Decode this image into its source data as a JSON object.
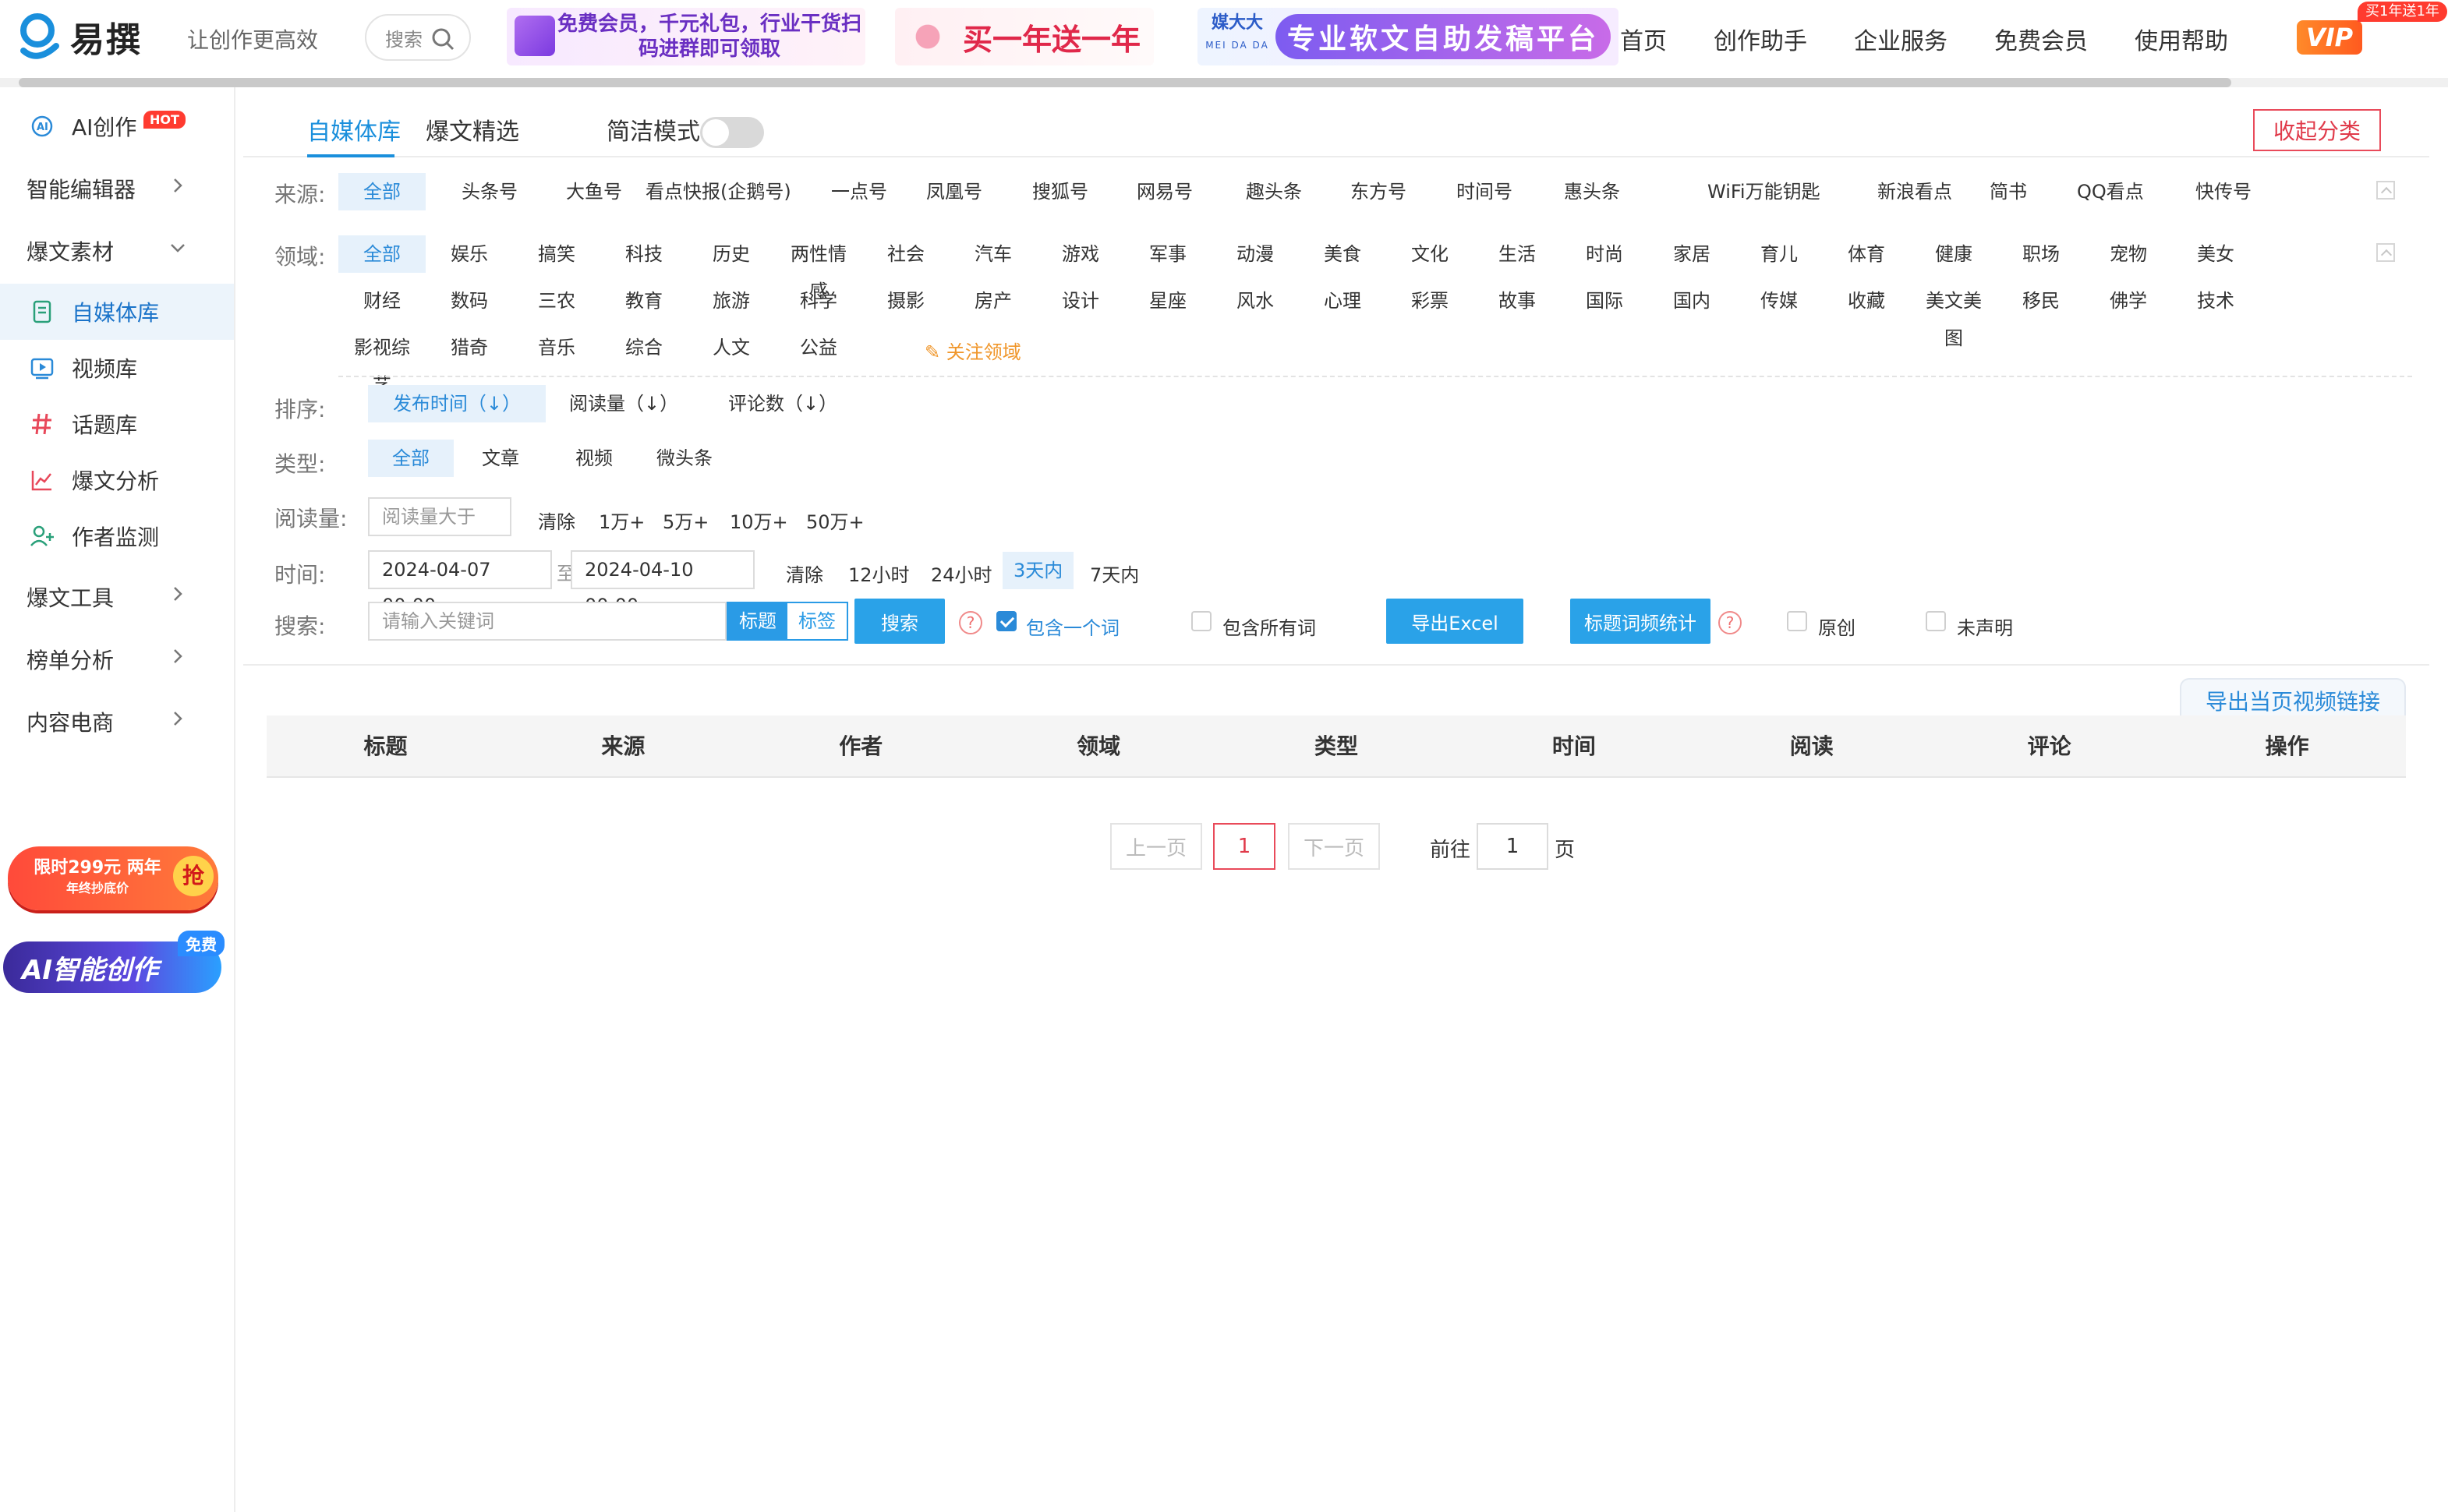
{
  "header": {
    "logo_text": "易撰",
    "slogan": "让创作更高效",
    "search_label": "搜索",
    "banner1": "免费会员，千元礼包，行业干货扫码进群即可领取",
    "banner2": "买一年送一年",
    "banner3_brand": "媒大大",
    "banner3_brand_sub": "MEI DA DA",
    "banner3": "专业软文自助发稿平台",
    "nav": [
      "首页",
      "创作助手",
      "企业服务",
      "免费会员",
      "使用帮助"
    ],
    "vip": "VIP",
    "vip_tag": "买1年送1年"
  },
  "sidebar": {
    "ai": "AI创作",
    "ai_badge": "HOT",
    "items": [
      {
        "label": "智能编辑器",
        "icon": "chevron-right-icon"
      },
      {
        "label": "爆文素材",
        "icon": "chevron-down-icon"
      },
      {
        "label": "自媒体库",
        "icon": "document-icon"
      },
      {
        "label": "视频库",
        "icon": "video-icon"
      },
      {
        "label": "话题库",
        "icon": "hashtag-icon"
      },
      {
        "label": "爆文分析",
        "icon": "line-chart-icon"
      },
      {
        "label": "作者监测",
        "icon": "add-user-icon"
      },
      {
        "label": "爆文工具",
        "icon": "chevron-right-icon"
      },
      {
        "label": "榜单分析",
        "icon": "chevron-right-icon"
      },
      {
        "label": "内容电商",
        "icon": "chevron-right-icon"
      }
    ],
    "promo1": "限时299元 两年",
    "promo1_sub": "年终抄底价",
    "promo1_badge": "抢",
    "promo2": "AI智能创作",
    "promo2_badge": "免费"
  },
  "main": {
    "tabs": [
      "自媒体库",
      "爆文精选"
    ],
    "mode_label": "简洁模式",
    "collapse_label": "收起分类",
    "source_label": "来源:",
    "sources": [
      "全部",
      "头条号",
      "大鱼号",
      "看点快报(企鹅号)",
      "一点号",
      "凤凰号",
      "搜狐号",
      "网易号",
      "趣头条",
      "东方号",
      "时间号",
      "惠头条",
      "WiFi万能钥匙",
      "新浪看点",
      "简书",
      "QQ看点",
      "快传号"
    ],
    "domain_label": "领域:",
    "domains_row1": [
      "全部",
      "娱乐",
      "搞笑",
      "科技",
      "历史",
      "两性情感",
      "社会",
      "汽车",
      "游戏",
      "军事",
      "动漫",
      "美食",
      "文化",
      "生活",
      "时尚",
      "家居",
      "育儿",
      "体育",
      "健康",
      "职场",
      "宠物",
      "美女"
    ],
    "domains_row2": [
      "财经",
      "数码",
      "三农",
      "教育",
      "旅游",
      "科学",
      "摄影",
      "房产",
      "设计",
      "星座",
      "风水",
      "心理",
      "彩票",
      "故事",
      "国际",
      "国内",
      "传媒",
      "收藏",
      "美文美图",
      "移民",
      "佛学",
      "技术"
    ],
    "domains_row3": [
      "影视综艺",
      "猎奇",
      "音乐",
      "综合",
      "人文",
      "公益"
    ],
    "follow_domain": "关注领域",
    "sort_label": "排序:",
    "sorts": [
      "发布时间（↓）",
      "阅读量（↓）",
      "评论数（↓）"
    ],
    "type_label": "类型:",
    "types": [
      "全部",
      "文章",
      "视频",
      "微头条"
    ],
    "read_label": "阅读量:",
    "read_placeholder": "阅读量大于",
    "read_options": [
      "清除",
      "1万+",
      "5万+",
      "10万+",
      "50万+"
    ],
    "time_label": "时间:",
    "time_start": "2024-04-07 00:00",
    "time_sep": "至",
    "time_end": "2024-04-10 00:00",
    "time_options": [
      "清除",
      "12小时",
      "24小时",
      "3天内",
      "7天内"
    ],
    "search_label": "搜索:",
    "search_placeholder": "请输入关键词",
    "tag_title": "标题",
    "tag_tag": "标签",
    "search_btn": "搜索",
    "include_one": "包含一个词",
    "include_all": "包含所有词",
    "export_excel": "导出Excel",
    "title_freq": "标题词频统计",
    "original": "原创",
    "undeclared": "未声明",
    "export_video": "导出当页视频链接",
    "columns": [
      "标题",
      "来源",
      "作者",
      "领域",
      "类型",
      "时间",
      "阅读",
      "评论",
      "操作"
    ],
    "pager_prev": "上一页",
    "pager_current": "1",
    "pager_next": "下一页",
    "pager_goto": "前往",
    "pager_page_value": "1",
    "pager_unit": "页"
  }
}
